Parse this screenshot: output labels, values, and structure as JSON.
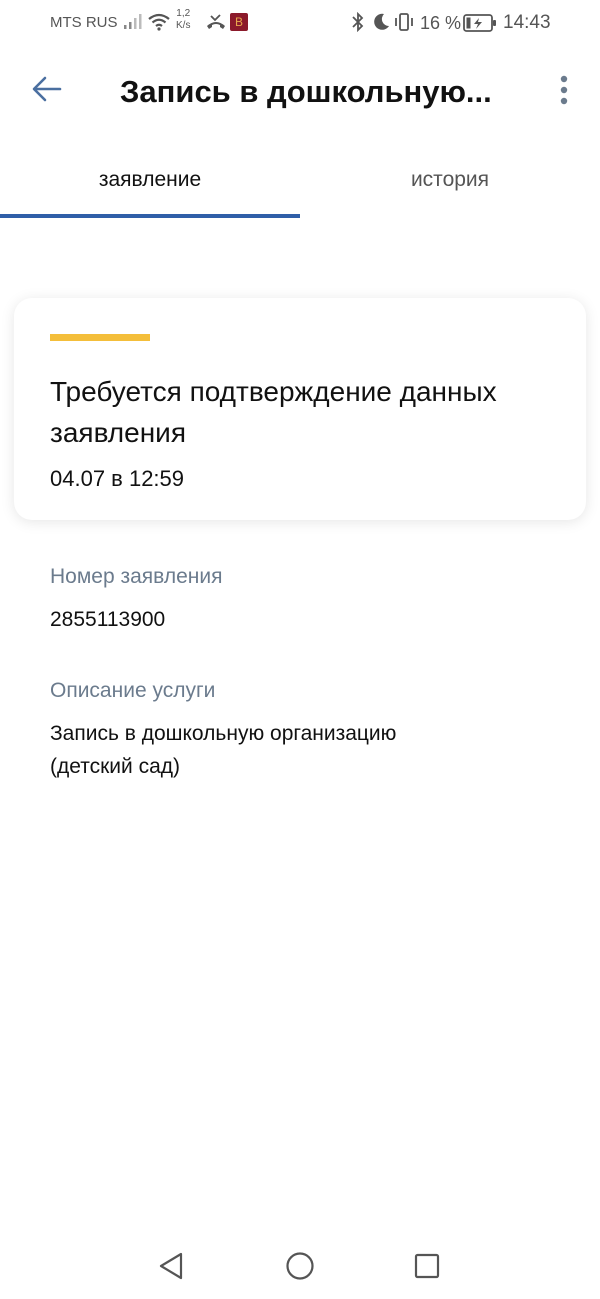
{
  "status_bar": {
    "carrier": "MTS RUS",
    "net_speed_value": "1,2",
    "net_speed_unit": "K/s",
    "app_icon_letter": "B",
    "battery": "16 %",
    "time": "14:43"
  },
  "header": {
    "title": "Запись в дошкольную...",
    "back_icon": "arrow-left-icon",
    "more_icon": "more-vertical-icon"
  },
  "tabs": [
    {
      "label": "заявление",
      "active": true
    },
    {
      "label": "история",
      "active": false
    }
  ],
  "status_card": {
    "accent_color": "#f4be3a",
    "title": "Требуется подтверждение данных заявления",
    "date": "04.07 в 12:59"
  },
  "details": {
    "number_label": "Номер заявления",
    "number_value": "2855113900",
    "service_label": "Описание услуги",
    "service_value_line1": "Запись в дошкольную организацию",
    "service_value_line2": "(детский сад)"
  },
  "colors": {
    "tab_indicator": "#2f5fa8",
    "label_gray": "#6b7b8d"
  }
}
